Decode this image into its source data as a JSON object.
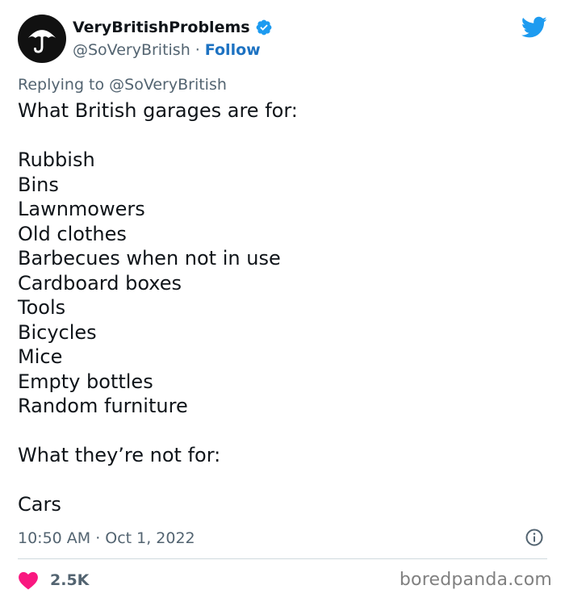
{
  "author": {
    "display_name": "VeryBritishProblems",
    "handle": "@SoVeryBritish",
    "separator": "·",
    "follow_label": "Follow",
    "verified_icon": "verified-badge-icon",
    "avatar_icon": "umbrella-icon"
  },
  "reply": {
    "prefix": "Replying to ",
    "handle": "@SoVeryBritish"
  },
  "tweet": {
    "lines": [
      "What British garages are for:",
      "",
      "Rubbish",
      "Bins",
      "Lawnmowers",
      "Old clothes",
      "Barbecues when not in use",
      "Cardboard boxes",
      "Tools",
      "Bicycles",
      "Mice",
      "Empty bottles",
      "Random furniture",
      "",
      "What they’re not for:",
      "",
      "Cars"
    ],
    "time": "10:50 AM",
    "date_separator": "·",
    "date": "Oct 1, 2022"
  },
  "footer": {
    "like_count": "2.5K",
    "watermark": "boredpanda.com"
  },
  "colors": {
    "link_blue": "#1d72c2",
    "twitter_blue": "#1d9bf0",
    "heart_pink": "#f91880",
    "muted_gray": "#536471",
    "text": "#0f1419"
  },
  "icons": [
    "umbrella-icon",
    "verified-badge-icon",
    "twitter-bird-icon",
    "info-icon",
    "heart-icon"
  ]
}
